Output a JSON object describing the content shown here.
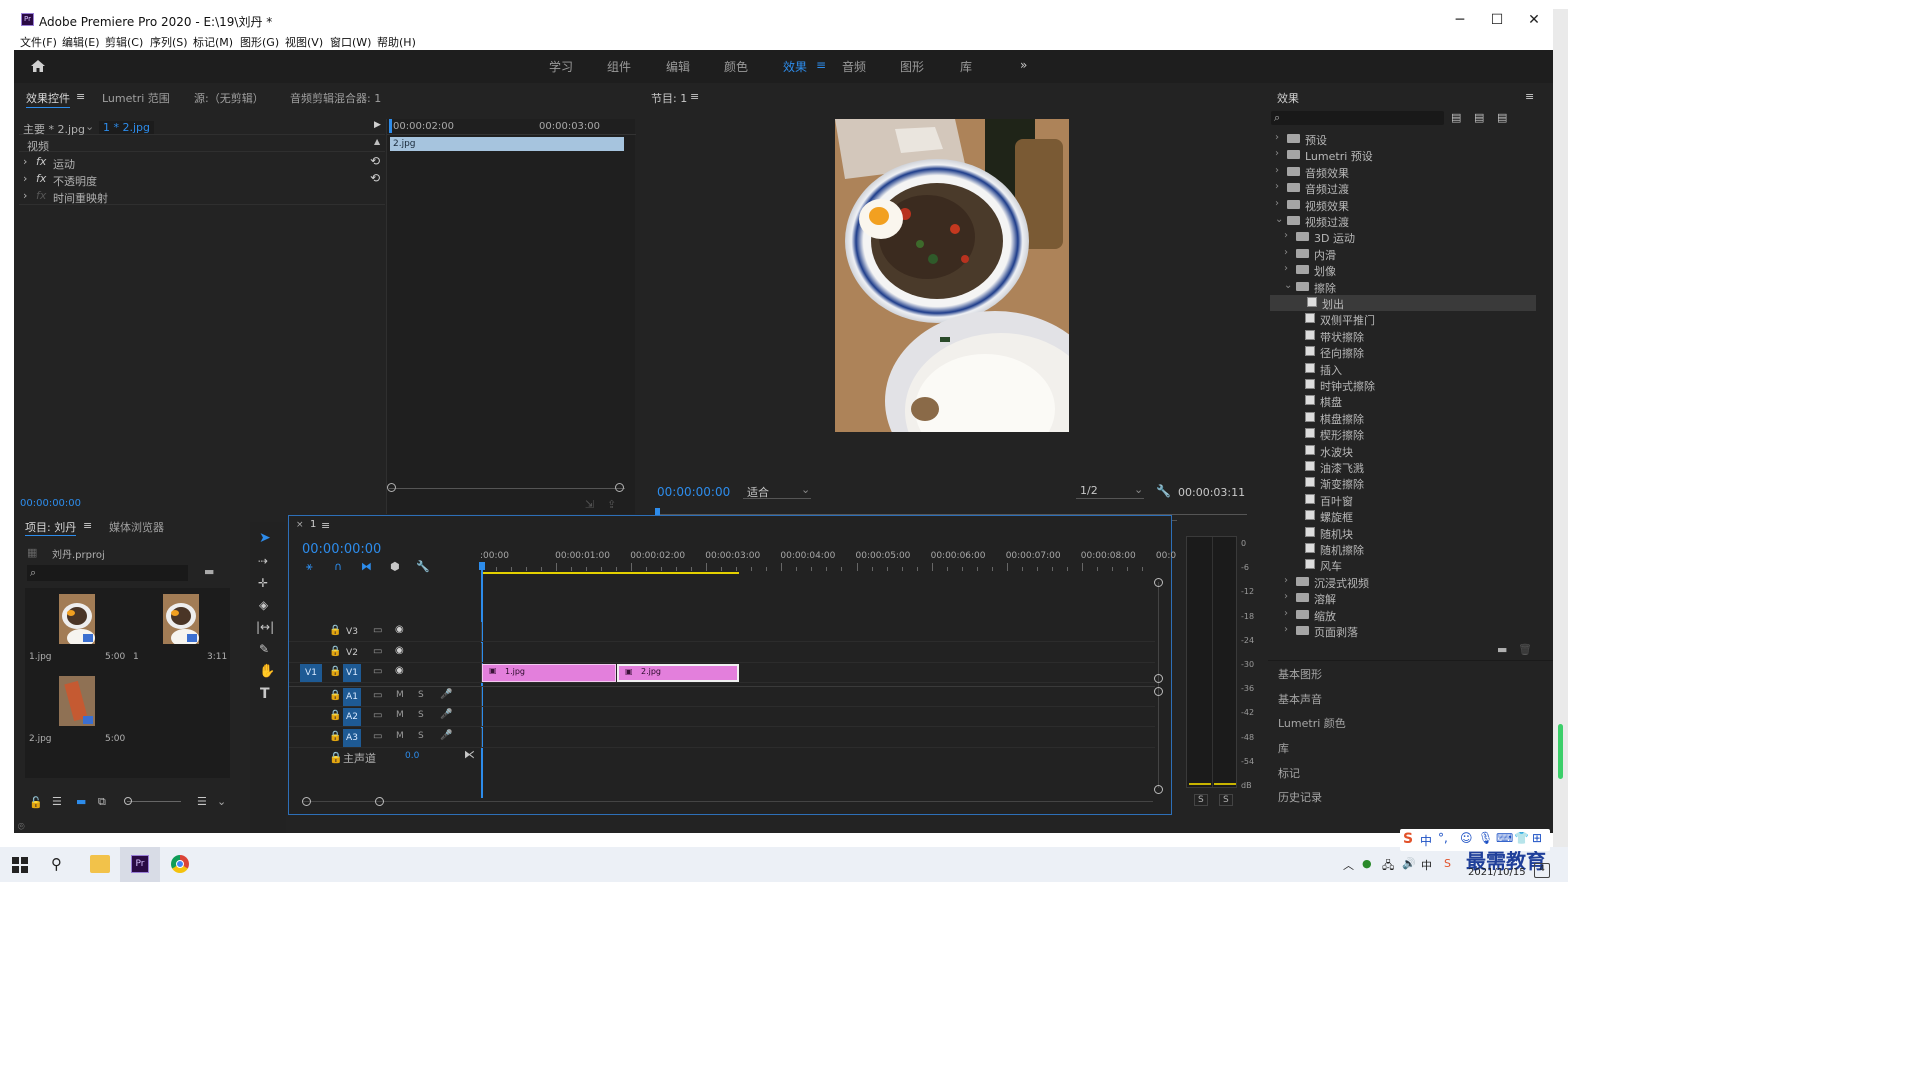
{
  "window": {
    "title": "Adobe Premiere Pro 2020 - E:\\19\\刘丹 *",
    "logo": "Pr",
    "minimize": "─",
    "maximize": "☐",
    "close": "✕"
  },
  "menu": [
    "文件(F)",
    "编辑(E)",
    "剪辑(C)",
    "序列(S)",
    "标记(M)",
    "图形(G)",
    "视图(V)",
    "窗口(W)",
    "帮助(H)"
  ],
  "workspaces": {
    "items": [
      "学习",
      "组件",
      "编辑",
      "颜色",
      "效果",
      "音频",
      "图形",
      "库"
    ],
    "active": "效果",
    "overflow": "»",
    "active_menu": "≡"
  },
  "effect_controls": {
    "tabs": [
      "效果控件",
      "Lumetri 范围",
      "源:（无剪辑）",
      "音频剪辑混合器: 1"
    ],
    "tab_menu": "≡",
    "master": "主要 * 2.jpg",
    "clip": "1 * 2.jpg",
    "time_marks": [
      "00:00:02:00",
      "00:00:03:00"
    ],
    "section": "视频",
    "effects": [
      {
        "fx": "fx",
        "name": "运动"
      },
      {
        "fx": "fx",
        "name": "不透明度"
      },
      {
        "fx": "fx",
        "name": "时间重映射"
      }
    ],
    "clip_bar": "2.jpg",
    "timecode": "00:00:00:00"
  },
  "program": {
    "title": "节目: 1",
    "menu": "≡",
    "timecode": "00:00:00:00",
    "fit": "适合",
    "resolution": "1/2",
    "duration": "00:00:03:11",
    "add": "+"
  },
  "effects_panel": {
    "title": "效果",
    "menu": "≡",
    "tree": [
      {
        "label": "预设",
        "level": 0,
        "type": "folder",
        "open": false
      },
      {
        "label": "Lumetri 预设",
        "level": 0,
        "type": "folder",
        "open": false
      },
      {
        "label": "音频效果",
        "level": 0,
        "type": "folder",
        "open": false
      },
      {
        "label": "音频过渡",
        "level": 0,
        "type": "folder",
        "open": false
      },
      {
        "label": "视频效果",
        "level": 0,
        "type": "folder",
        "open": false
      },
      {
        "label": "视频过渡",
        "level": 0,
        "type": "folder",
        "open": true
      },
      {
        "label": "3D 运动",
        "level": 1,
        "type": "folder",
        "open": false
      },
      {
        "label": "内滑",
        "level": 1,
        "type": "folder",
        "open": false
      },
      {
        "label": "划像",
        "level": 1,
        "type": "folder",
        "open": false
      },
      {
        "label": "擦除",
        "level": 1,
        "type": "folder",
        "open": true
      },
      {
        "label": "划出",
        "level": 2,
        "type": "effect",
        "selected": true
      },
      {
        "label": "双侧平推门",
        "level": 2,
        "type": "effect"
      },
      {
        "label": "带状擦除",
        "level": 2,
        "type": "effect"
      },
      {
        "label": "径向擦除",
        "level": 2,
        "type": "effect"
      },
      {
        "label": "插入",
        "level": 2,
        "type": "effect"
      },
      {
        "label": "时钟式擦除",
        "level": 2,
        "type": "effect"
      },
      {
        "label": "棋盘",
        "level": 2,
        "type": "effect"
      },
      {
        "label": "棋盘擦除",
        "level": 2,
        "type": "effect"
      },
      {
        "label": "楔形擦除",
        "level": 2,
        "type": "effect"
      },
      {
        "label": "水波块",
        "level": 2,
        "type": "effect"
      },
      {
        "label": "油漆飞溅",
        "level": 2,
        "type": "effect"
      },
      {
        "label": "渐变擦除",
        "level": 2,
        "type": "effect"
      },
      {
        "label": "百叶窗",
        "level": 2,
        "type": "effect"
      },
      {
        "label": "螺旋框",
        "level": 2,
        "type": "effect"
      },
      {
        "label": "随机块",
        "level": 2,
        "type": "effect"
      },
      {
        "label": "随机擦除",
        "level": 2,
        "type": "effect"
      },
      {
        "label": "风车",
        "level": 2,
        "type": "effect"
      },
      {
        "label": "沉浸式视频",
        "level": 1,
        "type": "folder",
        "open": false
      },
      {
        "label": "溶解",
        "level": 1,
        "type": "folder",
        "open": false
      },
      {
        "label": "缩放",
        "level": 1,
        "type": "folder",
        "open": false
      },
      {
        "label": "页面剥落",
        "level": 1,
        "type": "folder",
        "open": false
      }
    ],
    "panels": [
      "基本图形",
      "基本声音",
      "Lumetri 颜色",
      "库",
      "标记",
      "历史记录"
    ]
  },
  "project": {
    "tabs": [
      "项目: 刘丹",
      "媒体浏览器"
    ],
    "menu": "≡",
    "file": "刘丹.prproj",
    "items": [
      {
        "name": "1.jpg",
        "dur": "5:00"
      },
      {
        "name": "1",
        "dur": "3:11"
      },
      {
        "name": "2.jpg",
        "dur": "5:00"
      }
    ]
  },
  "timeline": {
    "close": "×",
    "name": "1",
    "menu": "≡",
    "timecode": "00:00:00:00",
    "ruler": [
      ":00:00",
      "00:00:01:00",
      "00:00:02:00",
      "00:00:03:00",
      "00:00:04:00",
      "00:00:05:00",
      "00:00:06:00",
      "00:00:07:00",
      "00:00:08:00",
      "00:0"
    ],
    "video_tracks": [
      "V3",
      "V2",
      "V1"
    ],
    "source_patch": "V1",
    "audio_tracks": [
      "A1",
      "A2",
      "A3"
    ],
    "mute": "M",
    "solo": "S",
    "master": {
      "label": "主声道",
      "value": "0.0"
    },
    "clips": [
      {
        "name": "1.jpg"
      },
      {
        "name": "2.jpg"
      }
    ]
  },
  "meter": {
    "scale": [
      "0",
      "-6",
      "-12",
      "-18",
      "-24",
      "-30",
      "-36",
      "-42",
      "-48",
      "-54",
      "dB"
    ],
    "solo": [
      "S",
      "S"
    ]
  },
  "taskbar": {
    "date": "2021/10/15",
    "watermark": "最需教育",
    "ime": "中"
  }
}
